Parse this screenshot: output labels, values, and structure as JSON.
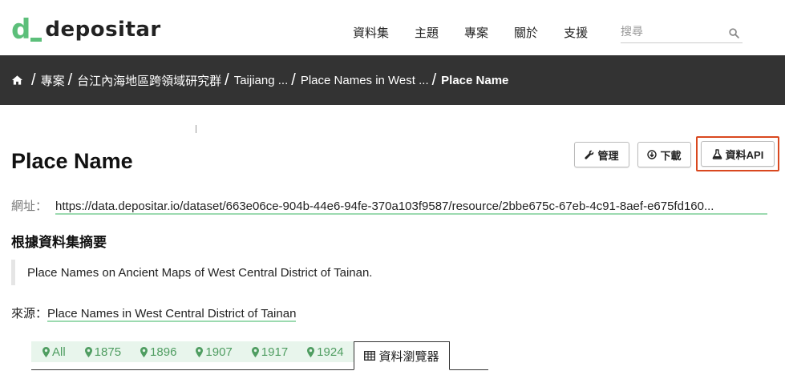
{
  "header": {
    "logo_letter": "d",
    "logo_text": "depositar",
    "nav": [
      "資料集",
      "主題",
      "專案",
      "關於",
      "支援"
    ],
    "search_placeholder": "搜尋"
  },
  "breadcrumb": {
    "items": [
      "專案",
      "台江內海地區跨領域研究群",
      "Taijiang ...",
      "Place Names in West ...",
      "Place Name"
    ]
  },
  "resource": {
    "title": "Place Name",
    "buttons": {
      "manage": "管理",
      "download": "下載",
      "api": "資料API"
    },
    "url_label": "網址：",
    "url": "https://data.depositar.io/dataset/663e06ce-904b-44e6-94fe-370a103f9587/resource/2bbe675c-67eb-4c91-8aef-e675fd160...",
    "summary_heading": "根據資料集摘要",
    "summary": "Place Names on Ancient Maps of West Central District of Tainan.",
    "source_label": "來源：",
    "source_link": "Place Names in West Central District of Tainan"
  },
  "tabs": {
    "items": [
      "All",
      "1875",
      "1896",
      "1907",
      "1917",
      "1924"
    ],
    "active": "資料瀏覽器"
  },
  "colors": {
    "brand_green": "#5cbf7a",
    "breadcrumb_bg": "#333333",
    "highlight_border": "#d9481f",
    "tab_bg": "#e8f5ec",
    "tab_text": "#4f9d61"
  }
}
